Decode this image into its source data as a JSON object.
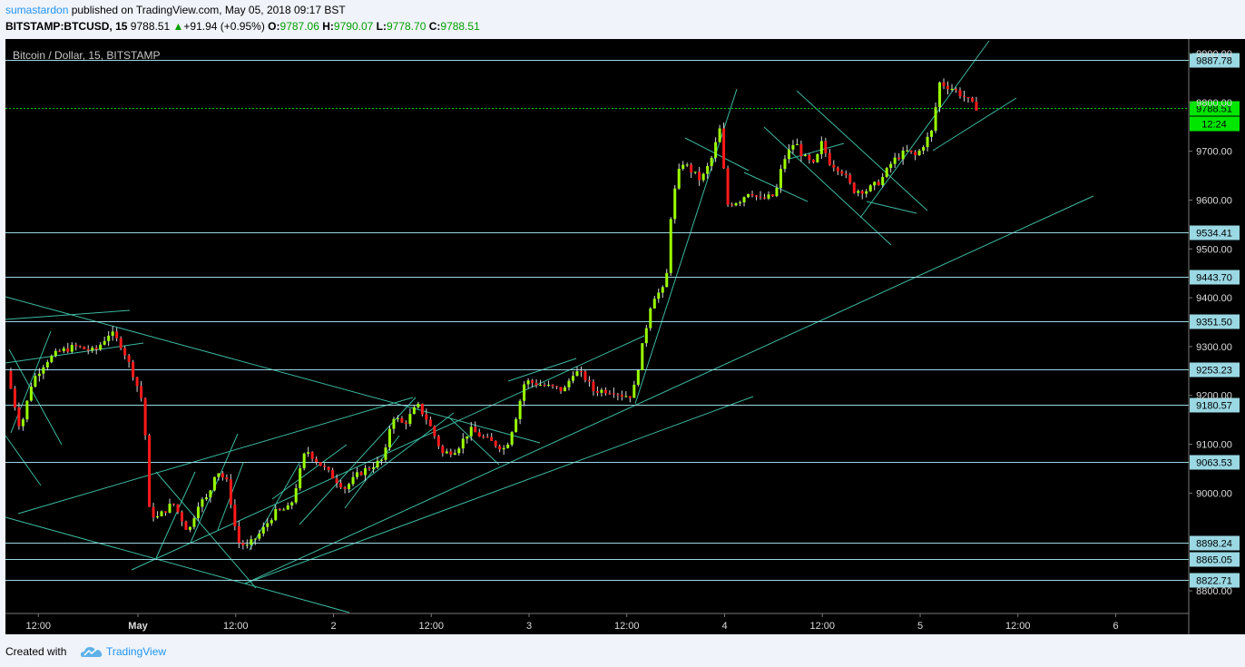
{
  "header": {
    "author": "sumastardon",
    "published": " published on TradingView.com, May 05, 2018 09:17 BST",
    "symbol": "BITSTAMP:BTCUSD, 15",
    "last": "9788.51",
    "change": "+91.94 (+0.95%)",
    "o_label": "O:",
    "o_val": "9787.06",
    "h_label": "H:",
    "h_val": "9790.07",
    "l_label": "L:",
    "l_val": "9778.70",
    "c_label": "C:",
    "c_val": "9788.51"
  },
  "footer": {
    "created_with": "Created with",
    "brand": "TradingView"
  },
  "colors": {
    "background": "#000000",
    "up_candle": "#9bff00",
    "down_candle": "#ff1a1a",
    "level_line": "#9ad8e3",
    "trend_line": "#3cb8a0",
    "price_label_bg": "#9ad8e3",
    "last_price_bg": "#00e600"
  },
  "chart_data": {
    "type": "candlestick",
    "title": "Bitcoin / Dollar, 15, BITSTAMP",
    "ylim": [
      8760,
      9920
    ],
    "y_ticks": [
      "8800.00",
      "9000.00",
      "9100.00",
      "9200.00",
      "9300.00",
      "9400.00",
      "9500.00",
      "9600.00",
      "9700.00",
      "9800.00",
      "9900.00"
    ],
    "x_ticks": [
      "12:00",
      "May",
      "12:00",
      "2",
      "12:00",
      "3",
      "12:00",
      "4",
      "12:00",
      "5",
      "12:00",
      "6"
    ],
    "horizontal_levels": [
      "9887.78",
      "9534.41",
      "9443.70",
      "9351.50",
      "9253.23",
      "9180.57",
      "9063.53",
      "8898.24",
      "8865.05",
      "8822.71"
    ],
    "last_price": "9788.51",
    "countdown": "12:24",
    "price_path_days": [
      [
        -0.65,
        9250
      ],
      [
        -0.58,
        9130
      ],
      [
        -0.52,
        9230
      ],
      [
        -0.45,
        9270
      ],
      [
        -0.38,
        9290
      ],
      [
        -0.3,
        9300
      ],
      [
        -0.2,
        9290
      ],
      [
        -0.12,
        9330
      ],
      [
        -0.06,
        9300
      ],
      [
        0.0,
        9240
      ],
      [
        0.05,
        9180
      ],
      [
        0.08,
        8960
      ],
      [
        0.12,
        8950
      ],
      [
        0.2,
        8980
      ],
      [
        0.28,
        8920
      ],
      [
        0.33,
        8980
      ],
      [
        0.38,
        8990
      ],
      [
        0.42,
        9050
      ],
      [
        0.48,
        9020
      ],
      [
        0.53,
        8900
      ],
      [
        0.58,
        8890
      ],
      [
        0.65,
        8920
      ],
      [
        0.72,
        8960
      ],
      [
        0.8,
        8970
      ],
      [
        0.88,
        9090
      ],
      [
        0.95,
        9060
      ],
      [
        1.0,
        9040
      ],
      [
        1.08,
        9010
      ],
      [
        1.15,
        9040
      ],
      [
        1.28,
        9070
      ],
      [
        1.32,
        9160
      ],
      [
        1.38,
        9140
      ],
      [
        1.45,
        9180
      ],
      [
        1.5,
        9150
      ],
      [
        1.58,
        9080
      ],
      [
        1.65,
        9090
      ],
      [
        1.72,
        9130
      ],
      [
        1.8,
        9110
      ],
      [
        1.85,
        9100
      ],
      [
        1.9,
        9090
      ],
      [
        1.95,
        9150
      ],
      [
        2.0,
        9230
      ],
      [
        2.1,
        9220
      ],
      [
        2.2,
        9210
      ],
      [
        2.25,
        9250
      ],
      [
        2.3,
        9240
      ],
      [
        2.35,
        9210
      ],
      [
        2.45,
        9210
      ],
      [
        2.5,
        9200
      ],
      [
        2.55,
        9200
      ],
      [
        2.6,
        9300
      ],
      [
        2.65,
        9400
      ],
      [
        2.72,
        9420
      ],
      [
        2.75,
        9590
      ],
      [
        2.8,
        9680
      ],
      [
        2.85,
        9660
      ],
      [
        2.9,
        9640
      ],
      [
        2.95,
        9680
      ],
      [
        3.0,
        9750
      ],
      [
        3.03,
        9590
      ],
      [
        3.1,
        9600
      ],
      [
        3.15,
        9620
      ],
      [
        3.2,
        9600
      ],
      [
        3.28,
        9610
      ],
      [
        3.32,
        9680
      ],
      [
        3.38,
        9720
      ],
      [
        3.42,
        9690
      ],
      [
        3.48,
        9670
      ],
      [
        3.52,
        9720
      ],
      [
        3.55,
        9680
      ],
      [
        3.62,
        9660
      ],
      [
        3.68,
        9620
      ],
      [
        3.75,
        9620
      ],
      [
        3.82,
        9640
      ],
      [
        3.88,
        9680
      ],
      [
        3.95,
        9700
      ],
      [
        4.0,
        9690
      ],
      [
        4.08,
        9740
      ],
      [
        4.12,
        9840
      ],
      [
        4.18,
        9830
      ],
      [
        4.25,
        9810
      ],
      [
        4.3,
        9790
      ]
    ]
  }
}
